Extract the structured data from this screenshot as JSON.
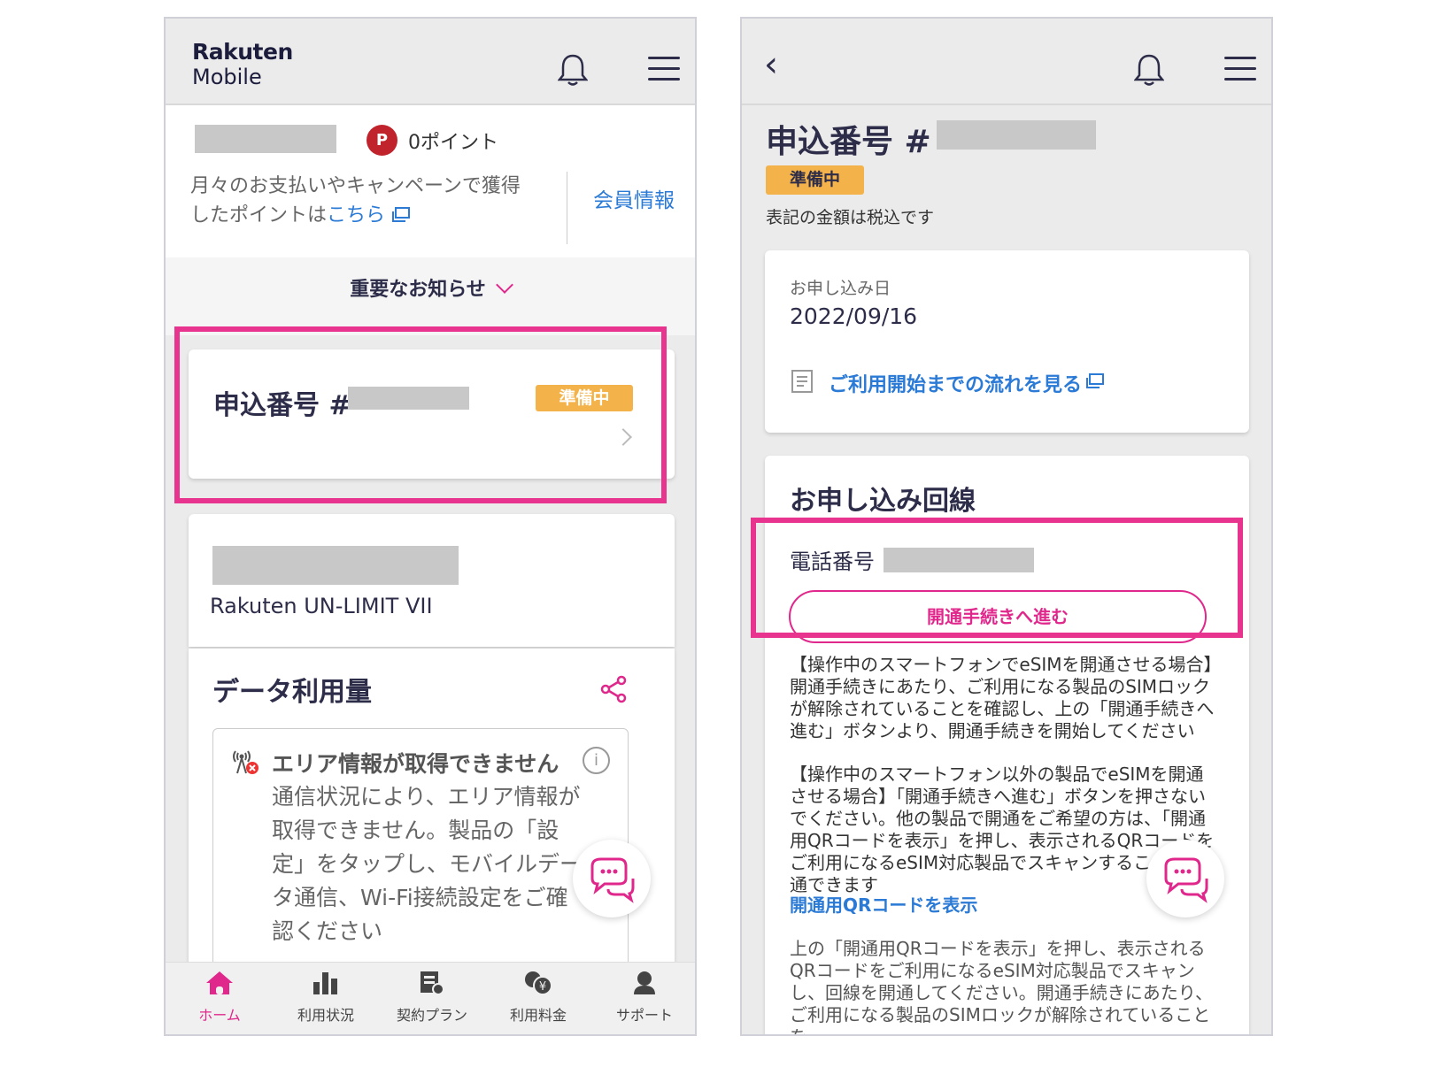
{
  "left_screen": {
    "logo": {
      "line1": "Rakuten",
      "line2": "Mobile"
    },
    "points_badge": "P",
    "points_label": "0ポイント",
    "points_desc_prefix": "月々のお支払いやキャンペーンで獲得したポイントは",
    "points_desc_link": "こちら",
    "member_info": "会員情報",
    "important_notice": "重要なお知らせ",
    "application": {
      "title": "申込番号 #",
      "status": "準備中"
    },
    "plan_name": "Rakuten UN-LIMIT VII",
    "data_usage_title": "データ利用量",
    "area_title": "エリア情報が取得できません",
    "area_text": "通信状況により、エリア情報が取得できません。製品の「設定」をタップし、モバイルデータ通信、Wi-Fi接続設定をご確認ください",
    "info_symbol": "i",
    "nav": [
      {
        "label": "ホーム",
        "icon": "home-icon",
        "active": true
      },
      {
        "label": "利用状況",
        "icon": "bar-chart-icon",
        "active": false
      },
      {
        "label": "契約プラン",
        "icon": "plan-icon",
        "active": false
      },
      {
        "label": "利用料金",
        "icon": "yen-icon",
        "active": false
      },
      {
        "label": "サポート",
        "icon": "support-icon",
        "active": false
      }
    ]
  },
  "right_screen": {
    "title": "申込番号 #",
    "status": "準備中",
    "tax_note": "表記の金額は税込です",
    "apply_date_label": "お申し込み日",
    "apply_date": "2022/09/16",
    "flow_link": "ご利用開始までの流れを見る",
    "line_section_title": "お申し込み回線",
    "phone_label": "電話番号",
    "activate_button": "開通手続きへ進む",
    "para1": "【操作中のスマートフォンでeSIMを開通させる場合】開通手続きにあたり、ご利用になる製品のSIMロックが解除されていることを確認し、上の「開通手続きへ進む」ボタンより、開通手続きを開始してください",
    "para2": "【操作中のスマートフォン以外の製品でeSIMを開通させる場合】「開通手続きへ進む」ボタンを押さないでください。他の製品で開通をご希望の方は、「開通用QRコードを表示」を押し、表示されるQRコードをご利用になるeSIM対応製品でスキャンすることで開通できます",
    "qr_link": "開通用QRコードを表示",
    "para3": "上の「開通用QRコードを表示」を押し、表示されるQRコードをご利用になるeSIM対応製品でスキャンし、回線を開通してください。開通手続きにあたり、ご利用になる製品のSIMロックが解除されていることを"
  },
  "colors": {
    "accent": "#e0288c",
    "highlight": "#e8338f",
    "status": "#f4b34a",
    "link": "#2a7ad6"
  }
}
